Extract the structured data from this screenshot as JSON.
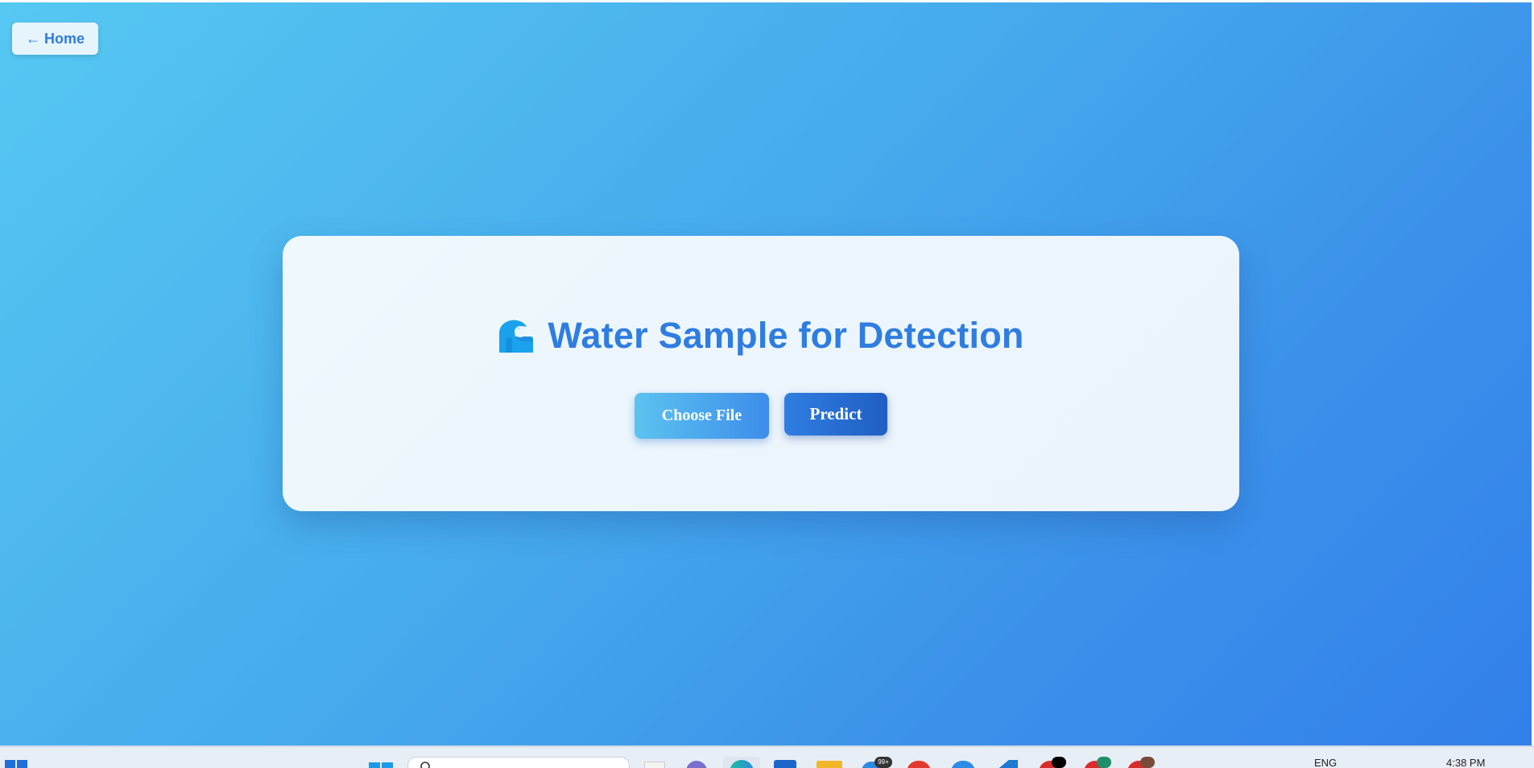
{
  "nav": {
    "home_label": "← Home"
  },
  "card": {
    "title": "Water Sample for Detection",
    "title_icon": "wave-icon",
    "choose_file_label": "Choose File",
    "predict_label": "Predict"
  },
  "taskbar": {
    "language": "ENG",
    "time": "4:38 PM",
    "badge_count": "99+",
    "icons": [
      "start-icon",
      "windows-icon",
      "search-box",
      "file-icon",
      "teams-icon",
      "edge-icon",
      "store-icon",
      "folder-icon",
      "chrome-icon",
      "app-red-icon",
      "app-blue-icon",
      "vscode-icon",
      "app-black-icon",
      "app-green-icon",
      "app-brown-icon"
    ]
  },
  "colors": {
    "accent": "#2f7de0",
    "predict_bg": "#2467cf",
    "choose_bg": "#4aa8ee",
    "background_start": "#56c8f2",
    "background_end": "#3280ea"
  }
}
